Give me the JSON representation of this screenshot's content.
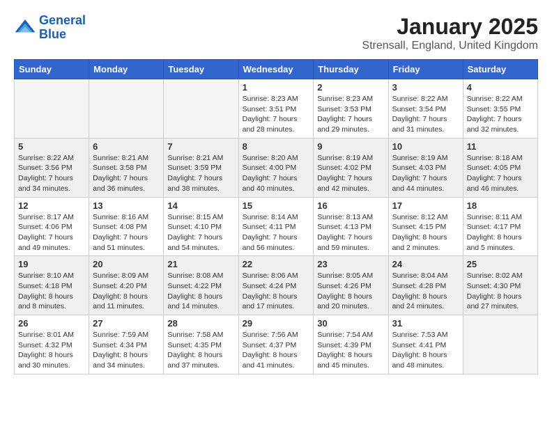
{
  "logo": {
    "line1": "General",
    "line2": "Blue"
  },
  "title": "January 2025",
  "location": "Strensall, England, United Kingdom",
  "days_header": [
    "Sunday",
    "Monday",
    "Tuesday",
    "Wednesday",
    "Thursday",
    "Friday",
    "Saturday"
  ],
  "weeks": [
    [
      {
        "day": "",
        "info": ""
      },
      {
        "day": "",
        "info": ""
      },
      {
        "day": "",
        "info": ""
      },
      {
        "day": "1",
        "info": "Sunrise: 8:23 AM\nSunset: 3:51 PM\nDaylight: 7 hours\nand 28 minutes."
      },
      {
        "day": "2",
        "info": "Sunrise: 8:23 AM\nSunset: 3:53 PM\nDaylight: 7 hours\nand 29 minutes."
      },
      {
        "day": "3",
        "info": "Sunrise: 8:22 AM\nSunset: 3:54 PM\nDaylight: 7 hours\nand 31 minutes."
      },
      {
        "day": "4",
        "info": "Sunrise: 8:22 AM\nSunset: 3:55 PM\nDaylight: 7 hours\nand 32 minutes."
      }
    ],
    [
      {
        "day": "5",
        "info": "Sunrise: 8:22 AM\nSunset: 3:56 PM\nDaylight: 7 hours\nand 34 minutes."
      },
      {
        "day": "6",
        "info": "Sunrise: 8:21 AM\nSunset: 3:58 PM\nDaylight: 7 hours\nand 36 minutes."
      },
      {
        "day": "7",
        "info": "Sunrise: 8:21 AM\nSunset: 3:59 PM\nDaylight: 7 hours\nand 38 minutes."
      },
      {
        "day": "8",
        "info": "Sunrise: 8:20 AM\nSunset: 4:00 PM\nDaylight: 7 hours\nand 40 minutes."
      },
      {
        "day": "9",
        "info": "Sunrise: 8:19 AM\nSunset: 4:02 PM\nDaylight: 7 hours\nand 42 minutes."
      },
      {
        "day": "10",
        "info": "Sunrise: 8:19 AM\nSunset: 4:03 PM\nDaylight: 7 hours\nand 44 minutes."
      },
      {
        "day": "11",
        "info": "Sunrise: 8:18 AM\nSunset: 4:05 PM\nDaylight: 7 hours\nand 46 minutes."
      }
    ],
    [
      {
        "day": "12",
        "info": "Sunrise: 8:17 AM\nSunset: 4:06 PM\nDaylight: 7 hours\nand 49 minutes."
      },
      {
        "day": "13",
        "info": "Sunrise: 8:16 AM\nSunset: 4:08 PM\nDaylight: 7 hours\nand 51 minutes."
      },
      {
        "day": "14",
        "info": "Sunrise: 8:15 AM\nSunset: 4:10 PM\nDaylight: 7 hours\nand 54 minutes."
      },
      {
        "day": "15",
        "info": "Sunrise: 8:14 AM\nSunset: 4:11 PM\nDaylight: 7 hours\nand 56 minutes."
      },
      {
        "day": "16",
        "info": "Sunrise: 8:13 AM\nSunset: 4:13 PM\nDaylight: 7 hours\nand 59 minutes."
      },
      {
        "day": "17",
        "info": "Sunrise: 8:12 AM\nSunset: 4:15 PM\nDaylight: 8 hours\nand 2 minutes."
      },
      {
        "day": "18",
        "info": "Sunrise: 8:11 AM\nSunset: 4:17 PM\nDaylight: 8 hours\nand 5 minutes."
      }
    ],
    [
      {
        "day": "19",
        "info": "Sunrise: 8:10 AM\nSunset: 4:18 PM\nDaylight: 8 hours\nand 8 minutes."
      },
      {
        "day": "20",
        "info": "Sunrise: 8:09 AM\nSunset: 4:20 PM\nDaylight: 8 hours\nand 11 minutes."
      },
      {
        "day": "21",
        "info": "Sunrise: 8:08 AM\nSunset: 4:22 PM\nDaylight: 8 hours\nand 14 minutes."
      },
      {
        "day": "22",
        "info": "Sunrise: 8:06 AM\nSunset: 4:24 PM\nDaylight: 8 hours\nand 17 minutes."
      },
      {
        "day": "23",
        "info": "Sunrise: 8:05 AM\nSunset: 4:26 PM\nDaylight: 8 hours\nand 20 minutes."
      },
      {
        "day": "24",
        "info": "Sunrise: 8:04 AM\nSunset: 4:28 PM\nDaylight: 8 hours\nand 24 minutes."
      },
      {
        "day": "25",
        "info": "Sunrise: 8:02 AM\nSunset: 4:30 PM\nDaylight: 8 hours\nand 27 minutes."
      }
    ],
    [
      {
        "day": "26",
        "info": "Sunrise: 8:01 AM\nSunset: 4:32 PM\nDaylight: 8 hours\nand 30 minutes."
      },
      {
        "day": "27",
        "info": "Sunrise: 7:59 AM\nSunset: 4:34 PM\nDaylight: 8 hours\nand 34 minutes."
      },
      {
        "day": "28",
        "info": "Sunrise: 7:58 AM\nSunset: 4:35 PM\nDaylight: 8 hours\nand 37 minutes."
      },
      {
        "day": "29",
        "info": "Sunrise: 7:56 AM\nSunset: 4:37 PM\nDaylight: 8 hours\nand 41 minutes."
      },
      {
        "day": "30",
        "info": "Sunrise: 7:54 AM\nSunset: 4:39 PM\nDaylight: 8 hours\nand 45 minutes."
      },
      {
        "day": "31",
        "info": "Sunrise: 7:53 AM\nSunset: 4:41 PM\nDaylight: 8 hours\nand 48 minutes."
      },
      {
        "day": "",
        "info": ""
      }
    ]
  ]
}
